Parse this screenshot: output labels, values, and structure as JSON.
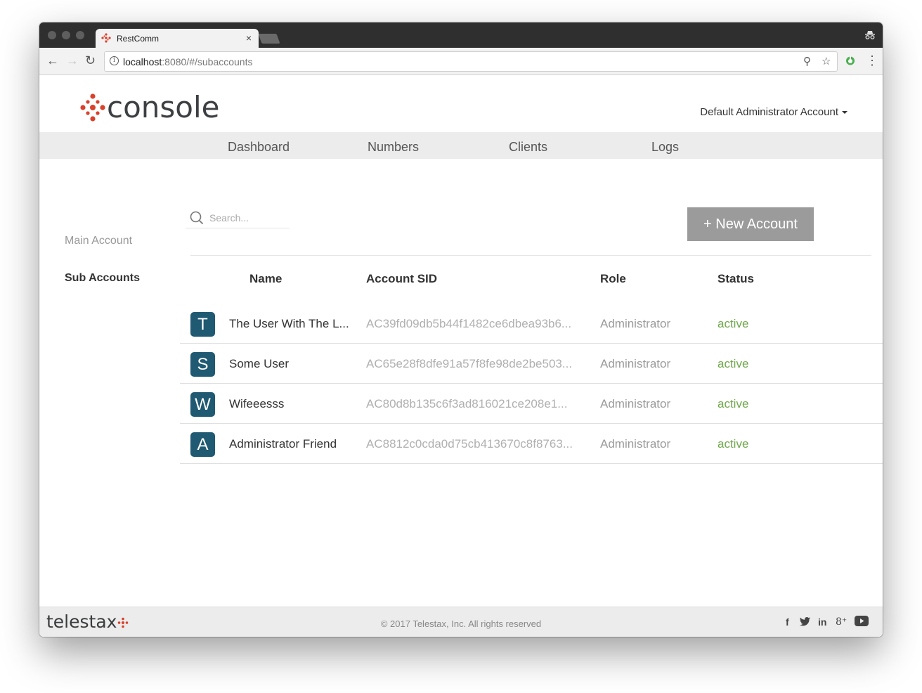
{
  "browser": {
    "tab_title": "RestComm",
    "tab_close": "×",
    "url_host": "localhost",
    "url_rest": ":8080/#/subaccounts"
  },
  "header": {
    "logo_text": "console",
    "account_menu_label": "Default Administrator Account"
  },
  "nav": {
    "items": [
      "Dashboard",
      "Numbers",
      "Clients",
      "Logs"
    ]
  },
  "sidebar": {
    "items": [
      {
        "label": "Main Account"
      },
      {
        "label": "Sub Accounts"
      }
    ]
  },
  "search": {
    "placeholder": "Search..."
  },
  "toolbar": {
    "new_account_label": "+ New Account"
  },
  "table": {
    "headers": [
      "Name",
      "Account SID",
      "Role",
      "Status"
    ],
    "rows": [
      {
        "initial": "T",
        "name": "The User With The L...",
        "sid": "AC39fd09db5b44f1482ce6dbea93b6...",
        "role": "Administrator",
        "status": "active"
      },
      {
        "initial": "S",
        "name": "Some User",
        "sid": "AC65e28f8dfe91a57f8fe98de2be503...",
        "role": "Administrator",
        "status": "active"
      },
      {
        "initial": "W",
        "name": "Wifeeesss",
        "sid": "AC80d8b135c6f3ad816021ce208e1...",
        "role": "Administrator",
        "status": "active"
      },
      {
        "initial": "A",
        "name": "Administrator Friend",
        "sid": "AC8812c0cda0d75cb413670c8f8763...",
        "role": "Administrator",
        "status": "active"
      }
    ]
  },
  "footer": {
    "logo_text": "telestax",
    "copyright": "© 2017 Telestax, Inc. All rights reserved",
    "social": [
      "f",
      "in",
      "8⁺"
    ]
  },
  "colors": {
    "accent_red": "#d9412b",
    "avatar_bg": "#1f5972",
    "status_active": "#6fa84a",
    "button_bg": "#9b9b9b",
    "sidebar_active": "#333333",
    "sidebar_inactive": "#999999"
  }
}
